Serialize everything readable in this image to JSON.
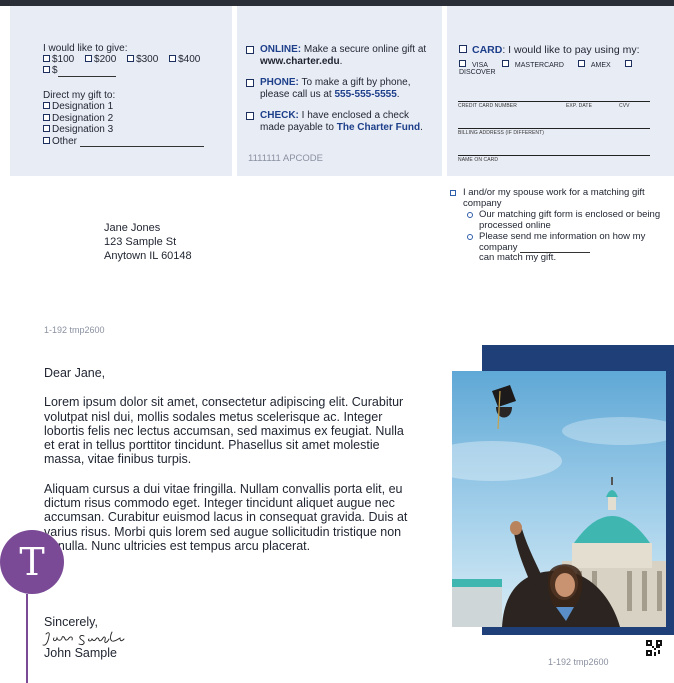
{
  "gift": {
    "give_label": "I would like to give:",
    "amounts": [
      "$100",
      "$200",
      "$300",
      "$400"
    ],
    "other_amount": "$",
    "direct_label": "Direct my gift to:",
    "designations": [
      "Designation 1",
      "Designation 2",
      "Designation 3",
      "Other"
    ]
  },
  "payment_methods": {
    "online": {
      "label": "ONLINE:",
      "text": "Make a secure online gift at",
      "url": "www.charter.edu",
      "end": "."
    },
    "phone": {
      "label": "PHONE:",
      "text": "To make a gift by phone, please call us at",
      "number": "555-555-5555",
      "end": "."
    },
    "check": {
      "label": "CHECK:",
      "text": "I have enclosed a check made payable to",
      "payee": "The Charter Fund",
      "end": "."
    },
    "apcode": "1111111  APCODE"
  },
  "card": {
    "label": "CARD",
    "text": ": I would like to pay using my:",
    "types": [
      "VISA",
      "MASTERCARD",
      "AMEX",
      "DISCOVER"
    ],
    "fields": {
      "number": "CREDIT CARD NUMBER",
      "exp": "EXP. DATE",
      "cvv": "CVV",
      "billing": "BILLING ADDRESS (IF DIFFERENT)",
      "name": "NAME ON CARD"
    }
  },
  "recipient": {
    "name": "Jane Jones",
    "street": "123 Sample St",
    "city": "Anytown IL 60148"
  },
  "matching": {
    "main": "I and/or my spouse work for a matching gift company",
    "opt1": "Our matching gift form is enclosed or being processed online",
    "opt2_a": "Please send me information on how my company",
    "opt2_b": "can match my gift."
  },
  "codes": {
    "left": "1-192  tmp2600",
    "right": "1-192  tmp2600"
  },
  "letter": {
    "greeting": "Dear Jane,",
    "para1": "Lorem ipsum dolor sit amet, consectetur adipiscing elit. Curabitur volutpat nisl dui, mollis sodales metus scelerisque ac. Integer lobortis felis nec lectus accumsan, sed maximus ex feugiat. Nulla et erat in tellus porttitor tincidunt. Phasellus sit amet molestie massa, vitae finibus turpis.",
    "para2": "Aliquam cursus a dui vitae fringilla. Nullam convallis porta elit, eu dictum risus commodo eget. Integer tincidunt aliquet augue nec accumsan. Curabitur euismod lacus in consequat gravida. Duis at varius risus. Morbi quis lorem sed augue sollicitudin tristique non at nulla. Nunc ultricies est tempus arcu placerat.",
    "closing": "Sincerely,",
    "signature": "John Sample",
    "sender": "John Sample"
  },
  "avatar_initial": "T",
  "colors": {
    "panel": "#e8ecf5",
    "navy": "#1f3f78",
    "accent_blue": "#1d3f8a",
    "avatar": "#7a4a96"
  }
}
